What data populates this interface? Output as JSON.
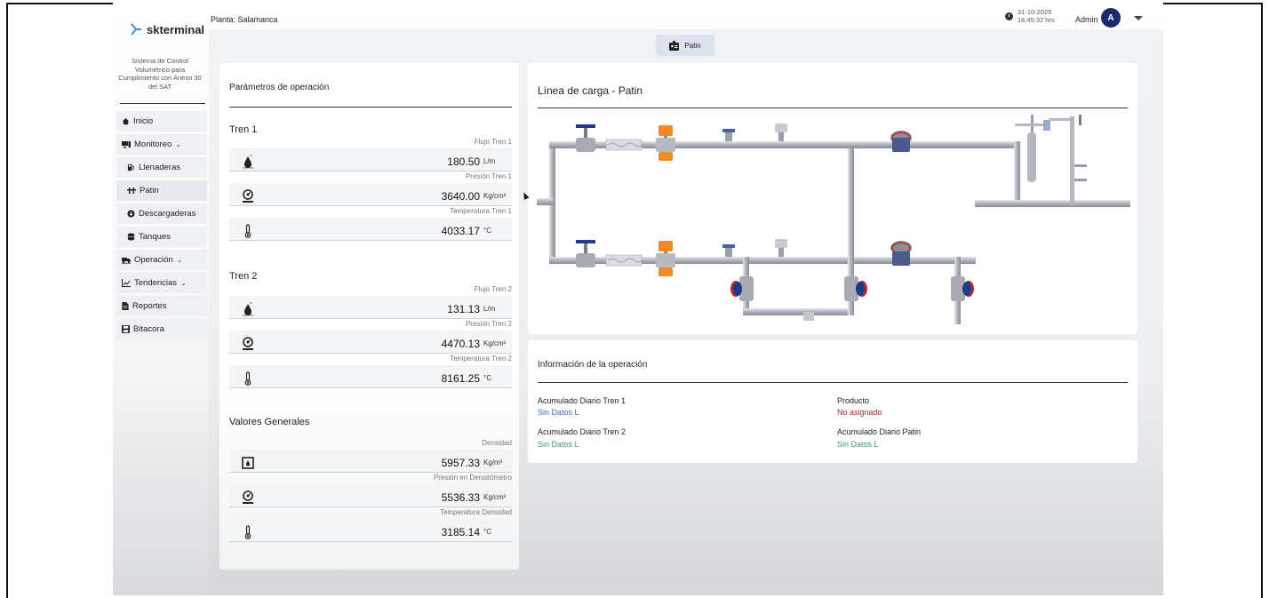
{
  "app": {
    "logo_text": "skterminal",
    "system_description": "Sistema de Control Volumétrico para Cumplimiento con Anexo 30 del SAT"
  },
  "header": {
    "plant": "Planta: Salamanca",
    "date": "31-10-2025",
    "time": "16:45:32 hrs",
    "user": "Admin",
    "avatar_initial": "A"
  },
  "sidebar": {
    "items": [
      {
        "label": "Inicio",
        "icon": "home-icon"
      },
      {
        "label": "Monitoreo",
        "icon": "monitor-icon"
      },
      {
        "label": "Llenaderas",
        "icon": "fuel-pump-icon"
      },
      {
        "label": "Patin",
        "icon": "skid-icon"
      },
      {
        "label": "Descargaderas",
        "icon": "download-circle-icon"
      },
      {
        "label": "Tanques",
        "icon": "database-icon"
      },
      {
        "label": "Operación",
        "icon": "truck-icon"
      },
      {
        "label": "Tendencias",
        "icon": "chart-icon"
      },
      {
        "label": "Reportes",
        "icon": "file-icon"
      },
      {
        "label": "Bitacora",
        "icon": "save-icon"
      }
    ]
  },
  "tab": {
    "label": "Patin",
    "icon": "badge-icon"
  },
  "parameters": {
    "title": "Parámetros de operación",
    "tren1": {
      "title": "Tren 1",
      "metrics": [
        {
          "label": "Flujo Tren 1",
          "value": "180.50",
          "unit": "L/m",
          "icon": "flow-drop-icon"
        },
        {
          "label": "Presión Tren 1",
          "value": "3640.00",
          "unit": "Kg/cm²",
          "icon": "gauge-icon"
        },
        {
          "label": "Temperatura Tren 1",
          "value": "4033.17",
          "unit": "°C",
          "icon": "thermometer-icon"
        }
      ]
    },
    "tren2": {
      "title": "Tren 2",
      "metrics": [
        {
          "label": "Flujo Tren 2",
          "value": "131.13",
          "unit": "L/m",
          "icon": "flow-drop-icon"
        },
        {
          "label": "Presión Tren 2",
          "value": "4470.13",
          "unit": "Kg/cm²",
          "icon": "gauge-icon"
        },
        {
          "label": "Temperatura Tren 2",
          "value": "8161.25",
          "unit": "°C",
          "icon": "thermometer-icon"
        }
      ]
    },
    "general": {
      "title": "Valores Generales",
      "metrics": [
        {
          "label": "Densidad",
          "value": "5957.33",
          "unit": "Kg/m³",
          "icon": "density-icon"
        },
        {
          "label": "Presión en Densitómetro",
          "value": "5536.33",
          "unit": "Kg/cm²",
          "icon": "gauge-icon"
        },
        {
          "label": "Temperatura Densidad",
          "value": "3185.14",
          "unit": "°C",
          "icon": "thermometer-icon"
        }
      ]
    }
  },
  "diagram": {
    "title": "Línea de carga - Patin"
  },
  "info": {
    "title": "Información de la operación",
    "acum_tren1_label": "Acumulado Diario Tren 1",
    "acum_tren1_value": "Sin Datos L",
    "producto_label": "Producto",
    "producto_value": "No asignado",
    "acum_tren2_label": "Acumulado Diario Tren 2",
    "acum_tren2_value": "Sin Datos L",
    "acum_patin_label": "Acumulado Diario Patin",
    "acum_patin_value": "Sin Datos L"
  },
  "colors": {
    "avatar": "#1e2a6e",
    "link_blue": "#3b6bb5",
    "alert_red": "#b0262e",
    "ok_green": "#35a56a",
    "pipe": "#b9bcc2",
    "valve_orange": "#f08a24",
    "valve_blue": "#1e3a8a"
  }
}
